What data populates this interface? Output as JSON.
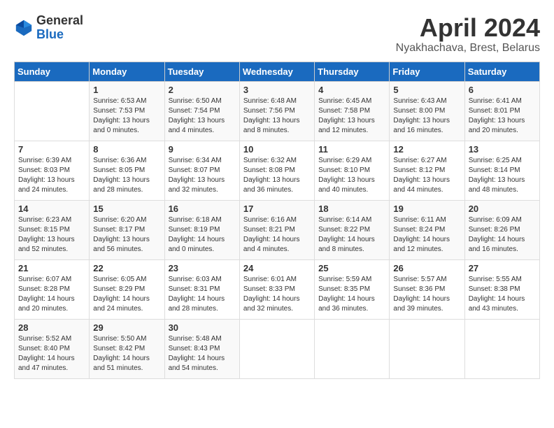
{
  "header": {
    "logo_general": "General",
    "logo_blue": "Blue",
    "title": "April 2024",
    "subtitle": "Nyakhachava, Brest, Belarus"
  },
  "calendar": {
    "days_of_week": [
      "Sunday",
      "Monday",
      "Tuesday",
      "Wednesday",
      "Thursday",
      "Friday",
      "Saturday"
    ],
    "weeks": [
      [
        {
          "day": "",
          "sunrise": "",
          "sunset": "",
          "daylight": ""
        },
        {
          "day": "1",
          "sunrise": "6:53 AM",
          "sunset": "7:53 PM",
          "daylight": "13 hours and 0 minutes."
        },
        {
          "day": "2",
          "sunrise": "6:50 AM",
          "sunset": "7:54 PM",
          "daylight": "13 hours and 4 minutes."
        },
        {
          "day": "3",
          "sunrise": "6:48 AM",
          "sunset": "7:56 PM",
          "daylight": "13 hours and 8 minutes."
        },
        {
          "day": "4",
          "sunrise": "6:45 AM",
          "sunset": "7:58 PM",
          "daylight": "13 hours and 12 minutes."
        },
        {
          "day": "5",
          "sunrise": "6:43 AM",
          "sunset": "8:00 PM",
          "daylight": "13 hours and 16 minutes."
        },
        {
          "day": "6",
          "sunrise": "6:41 AM",
          "sunset": "8:01 PM",
          "daylight": "13 hours and 20 minutes."
        }
      ],
      [
        {
          "day": "7",
          "sunrise": "6:39 AM",
          "sunset": "8:03 PM",
          "daylight": "13 hours and 24 minutes."
        },
        {
          "day": "8",
          "sunrise": "6:36 AM",
          "sunset": "8:05 PM",
          "daylight": "13 hours and 28 minutes."
        },
        {
          "day": "9",
          "sunrise": "6:34 AM",
          "sunset": "8:07 PM",
          "daylight": "13 hours and 32 minutes."
        },
        {
          "day": "10",
          "sunrise": "6:32 AM",
          "sunset": "8:08 PM",
          "daylight": "13 hours and 36 minutes."
        },
        {
          "day": "11",
          "sunrise": "6:29 AM",
          "sunset": "8:10 PM",
          "daylight": "13 hours and 40 minutes."
        },
        {
          "day": "12",
          "sunrise": "6:27 AM",
          "sunset": "8:12 PM",
          "daylight": "13 hours and 44 minutes."
        },
        {
          "day": "13",
          "sunrise": "6:25 AM",
          "sunset": "8:14 PM",
          "daylight": "13 hours and 48 minutes."
        }
      ],
      [
        {
          "day": "14",
          "sunrise": "6:23 AM",
          "sunset": "8:15 PM",
          "daylight": "13 hours and 52 minutes."
        },
        {
          "day": "15",
          "sunrise": "6:20 AM",
          "sunset": "8:17 PM",
          "daylight": "13 hours and 56 minutes."
        },
        {
          "day": "16",
          "sunrise": "6:18 AM",
          "sunset": "8:19 PM",
          "daylight": "14 hours and 0 minutes."
        },
        {
          "day": "17",
          "sunrise": "6:16 AM",
          "sunset": "8:21 PM",
          "daylight": "14 hours and 4 minutes."
        },
        {
          "day": "18",
          "sunrise": "6:14 AM",
          "sunset": "8:22 PM",
          "daylight": "14 hours and 8 minutes."
        },
        {
          "day": "19",
          "sunrise": "6:11 AM",
          "sunset": "8:24 PM",
          "daylight": "14 hours and 12 minutes."
        },
        {
          "day": "20",
          "sunrise": "6:09 AM",
          "sunset": "8:26 PM",
          "daylight": "14 hours and 16 minutes."
        }
      ],
      [
        {
          "day": "21",
          "sunrise": "6:07 AM",
          "sunset": "8:28 PM",
          "daylight": "14 hours and 20 minutes."
        },
        {
          "day": "22",
          "sunrise": "6:05 AM",
          "sunset": "8:29 PM",
          "daylight": "14 hours and 24 minutes."
        },
        {
          "day": "23",
          "sunrise": "6:03 AM",
          "sunset": "8:31 PM",
          "daylight": "14 hours and 28 minutes."
        },
        {
          "day": "24",
          "sunrise": "6:01 AM",
          "sunset": "8:33 PM",
          "daylight": "14 hours and 32 minutes."
        },
        {
          "day": "25",
          "sunrise": "5:59 AM",
          "sunset": "8:35 PM",
          "daylight": "14 hours and 36 minutes."
        },
        {
          "day": "26",
          "sunrise": "5:57 AM",
          "sunset": "8:36 PM",
          "daylight": "14 hours and 39 minutes."
        },
        {
          "day": "27",
          "sunrise": "5:55 AM",
          "sunset": "8:38 PM",
          "daylight": "14 hours and 43 minutes."
        }
      ],
      [
        {
          "day": "28",
          "sunrise": "5:52 AM",
          "sunset": "8:40 PM",
          "daylight": "14 hours and 47 minutes."
        },
        {
          "day": "29",
          "sunrise": "5:50 AM",
          "sunset": "8:42 PM",
          "daylight": "14 hours and 51 minutes."
        },
        {
          "day": "30",
          "sunrise": "5:48 AM",
          "sunset": "8:43 PM",
          "daylight": "14 hours and 54 minutes."
        },
        {
          "day": "",
          "sunrise": "",
          "sunset": "",
          "daylight": ""
        },
        {
          "day": "",
          "sunrise": "",
          "sunset": "",
          "daylight": ""
        },
        {
          "day": "",
          "sunrise": "",
          "sunset": "",
          "daylight": ""
        },
        {
          "day": "",
          "sunrise": "",
          "sunset": "",
          "daylight": ""
        }
      ]
    ]
  }
}
